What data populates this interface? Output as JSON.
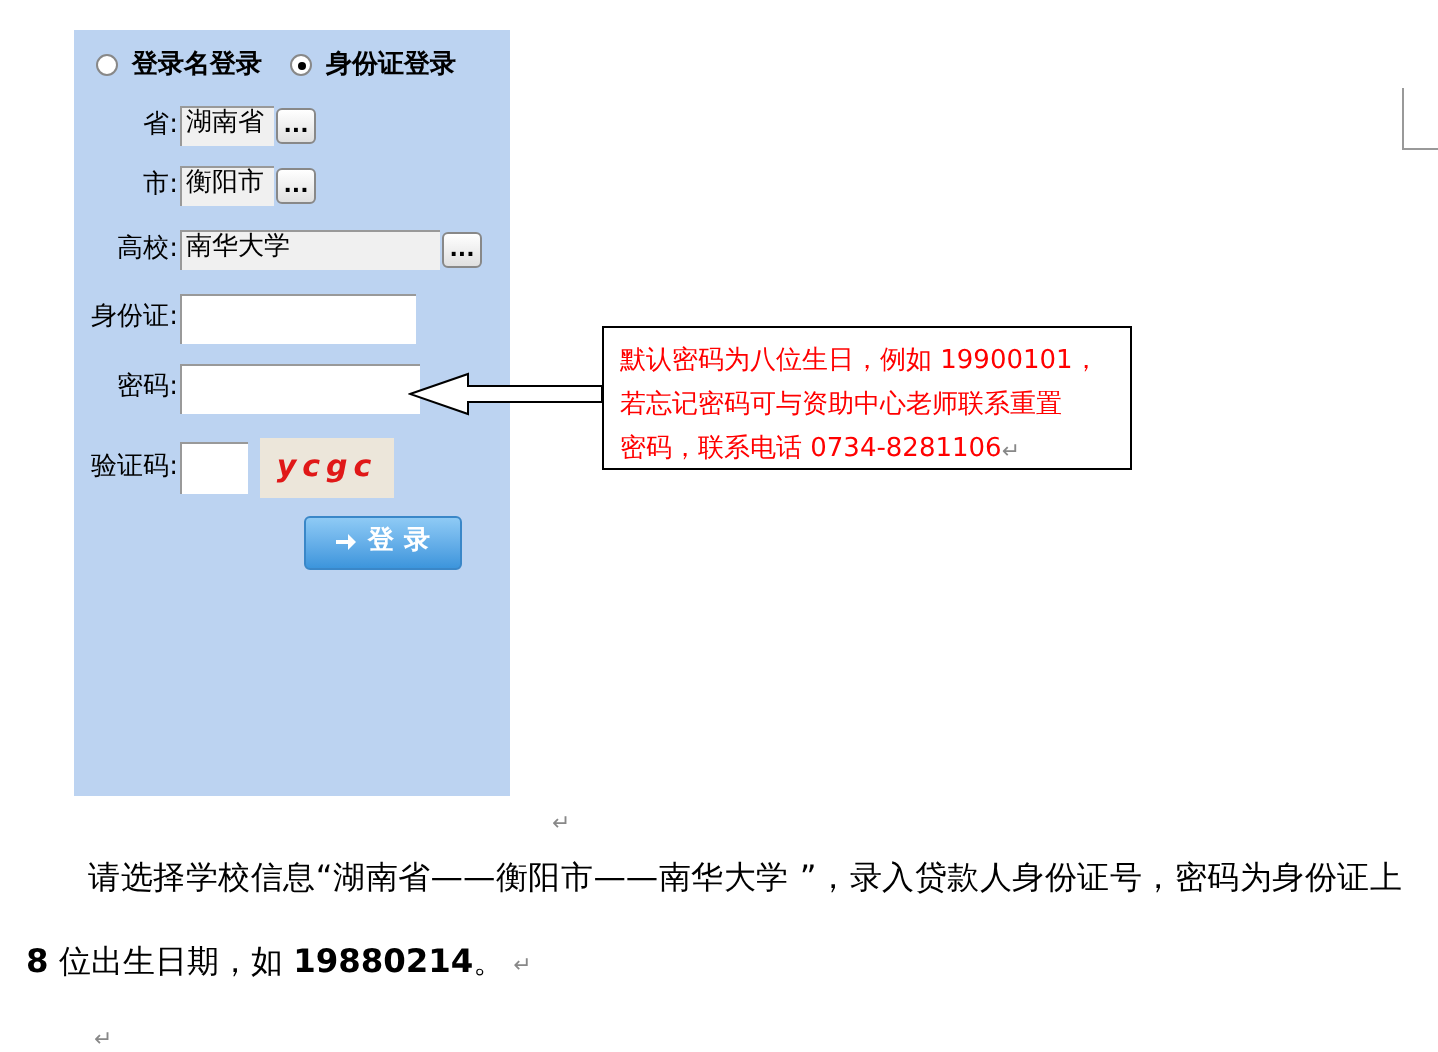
{
  "login_form": {
    "modes": [
      {
        "label": "登录名登录",
        "selected": false
      },
      {
        "label": "身份证登录",
        "selected": true
      }
    ],
    "fields": [
      {
        "kind": "short_select",
        "label": "省:",
        "value": "湖南省",
        "button": "..."
      },
      {
        "kind": "short_select",
        "label": "市:",
        "value": "衡阳市",
        "button": "..."
      },
      {
        "kind": "long_select",
        "label": "高校:",
        "value": "南华大学",
        "button": "..."
      },
      {
        "kind": "text",
        "label": "身份证:"
      },
      {
        "kind": "password",
        "label": "密码:"
      },
      {
        "kind": "captcha",
        "label": "验证码:",
        "captcha": "ycgc"
      }
    ],
    "submit": "登 录"
  },
  "after_image_mark": "↵",
  "callout": {
    "lines": [
      "默认密码为八位生日，例如 19900101，",
      "若忘记密码可与资助中心老师联系重置",
      "密码，联系电话 0734-8281106"
    ],
    "mark": "↵"
  },
  "paragraph": {
    "text": "请选择学校信息“湖南省——衡阳市——南华大学 ”，录入贷款人身份证号，密码为身份证上 **8** 位出生日期，如 **19880214**。",
    "mark": "↵"
  },
  "empty_line_mark": "↵"
}
